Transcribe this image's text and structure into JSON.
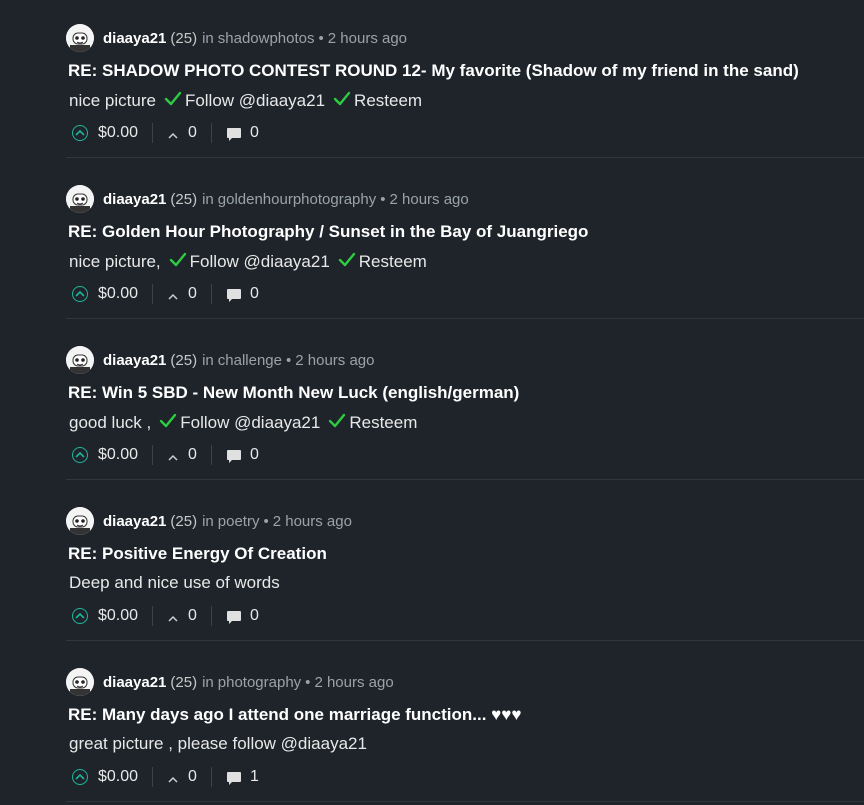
{
  "colors": {
    "background": "#1e242a",
    "divider": "#2f373f",
    "check_green": "#2ecc40",
    "upvote_teal": "#1fb59b",
    "meta_gray": "#9aa3ab"
  },
  "icons": {
    "avatar": "avatar-icon",
    "check": "check-icon",
    "upvote": "upvote-icon",
    "downvote": "chevron-up-icon",
    "comments": "comment-bubble-icon"
  },
  "posts": [
    {
      "author": "diaaya21",
      "reputation": "(25)",
      "in_word": "in",
      "community": "shadowphotos",
      "dot": "•",
      "time": "2 hours ago",
      "title": "RE: SHADOW PHOTO CONTEST ROUND 12- My favorite (Shadow of my friend in the sand)",
      "body": "nice picture",
      "tags": [
        " Follow @diaaya21",
        " Resteem"
      ],
      "payout": "$0.00",
      "votes": "0",
      "comments": "0"
    },
    {
      "author": "diaaya21",
      "reputation": "(25)",
      "in_word": "in",
      "community": "goldenhourphotography",
      "dot": "•",
      "time": "2 hours ago",
      "title": "RE: Golden Hour Photography / Sunset in the Bay of Juangriego",
      "body": "nice picture,",
      "tags": [
        " Follow @diaaya21",
        " Resteem"
      ],
      "payout": "$0.00",
      "votes": "0",
      "comments": "0"
    },
    {
      "author": "diaaya21",
      "reputation": "(25)",
      "in_word": "in",
      "community": "challenge",
      "dot": "•",
      "time": "2 hours ago",
      "title": "RE: Win 5 SBD - New Month New Luck (english/german)",
      "body": "good luck ,",
      "tags": [
        " Follow @diaaya21",
        " Resteem"
      ],
      "payout": "$0.00",
      "votes": "0",
      "comments": "0"
    },
    {
      "author": "diaaya21",
      "reputation": "(25)",
      "in_word": "in",
      "community": "poetry",
      "dot": "•",
      "time": "2 hours ago",
      "title": "RE: Positive Energy Of Creation",
      "body": "Deep and nice use of words",
      "tags": [],
      "payout": "$0.00",
      "votes": "0",
      "comments": "0"
    },
    {
      "author": "diaaya21",
      "reputation": "(25)",
      "in_word": "in",
      "community": "photography",
      "dot": "•",
      "time": "2 hours ago",
      "title": "RE: Many days ago I attend one marriage function... ♥♥♥",
      "body": "great picture , please follow @diaaya21",
      "tags": [],
      "payout": "$0.00",
      "votes": "0",
      "comments": "1"
    }
  ]
}
